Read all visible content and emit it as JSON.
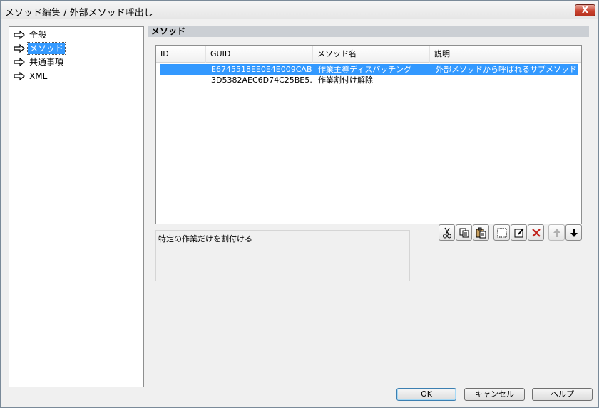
{
  "window": {
    "title": "メソッド編集 / 外部メソッド呼出し",
    "close_label": "X"
  },
  "tree": {
    "items": [
      {
        "label": "全般",
        "selected": false
      },
      {
        "label": "メソッド",
        "selected": true
      },
      {
        "label": "共通事項",
        "selected": false
      },
      {
        "label": "XML",
        "selected": false
      }
    ]
  },
  "section": {
    "title": "メソッド"
  },
  "methods_table": {
    "columns": [
      "ID",
      "GUID",
      "メソッド名",
      "説明"
    ],
    "rows": [
      {
        "id": "",
        "guid": "E6745518EE0E4E009CAB…",
        "name": "作業主導ディスパッチング",
        "desc": "外部メソッドから呼ばれるサブメソッドテスト",
        "selected": true
      },
      {
        "id": "",
        "guid": "3D5382AEC6D74C25BE5…",
        "name": "作業割付け解除",
        "desc": "",
        "selected": false
      }
    ]
  },
  "description": {
    "text": "特定の作業だけを割付ける"
  },
  "toolbar": {
    "cut_icon": "cut-icon",
    "copy_icon": "copy-icon",
    "paste_icon": "paste-icon",
    "new_icon": "new-icon",
    "edit_icon": "edit-icon",
    "delete_icon": "delete-icon",
    "up_icon": "move-up-icon",
    "down_icon": "move-down-icon"
  },
  "buttons": {
    "ok": "OK",
    "cancel": "キャンセル",
    "help": "ヘルプ"
  },
  "colors": {
    "selection": "#3399ff",
    "section_header": "#cbcfd4"
  }
}
